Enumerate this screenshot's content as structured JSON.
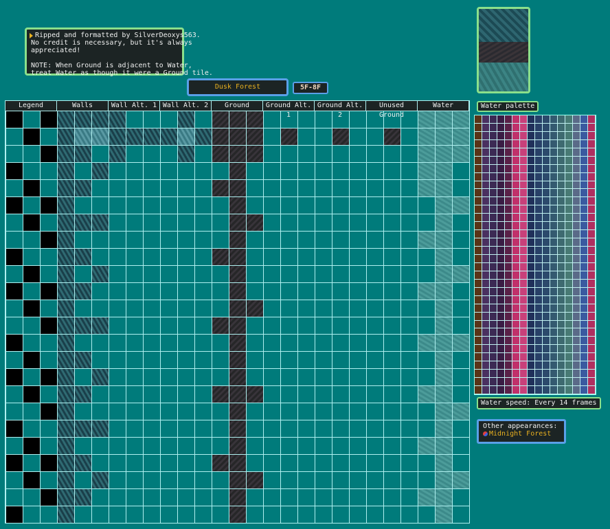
{
  "credit": {
    "lines": [
      "Ripped and formatted by SilverDeoxys563.",
      "No credit is necessary, but it's always",
      "appreciated!",
      "",
      "NOTE: When Ground is adjacent to Water,",
      "treat Water as though it were a Ground tile."
    ]
  },
  "title": "Dusk Forest",
  "floor_badge": "5F-8F",
  "water_palette_label": "Water palette",
  "water_speed": "Water speed: Every 14 frames",
  "other": {
    "heading": "Other appearances:",
    "link": "Midnight Forest"
  },
  "columns": [
    "Legend",
    "Walls",
    "Wall Alt. 1",
    "Wall Alt. 2",
    "Ground",
    "Ground Alt. 1",
    "Ground Alt. 2",
    "Unused Ground",
    "Water"
  ],
  "palette_colors": [
    "#5a3418",
    "#4a3060",
    "#3c2a54",
    "#3a1c44",
    "#5a2048",
    "#c0306a",
    "#c8407a",
    "#20305a",
    "#284068",
    "#2c4a6c",
    "#345a70",
    "#3e6a70",
    "#487a74",
    "#5a6a88",
    "#3a5aa0",
    "#b03060"
  ],
  "colors": {
    "background": "#007b7b",
    "frame_green": "#8be08b",
    "frame_blue": "#5aa0e8",
    "text_gold": "#e8b020"
  }
}
